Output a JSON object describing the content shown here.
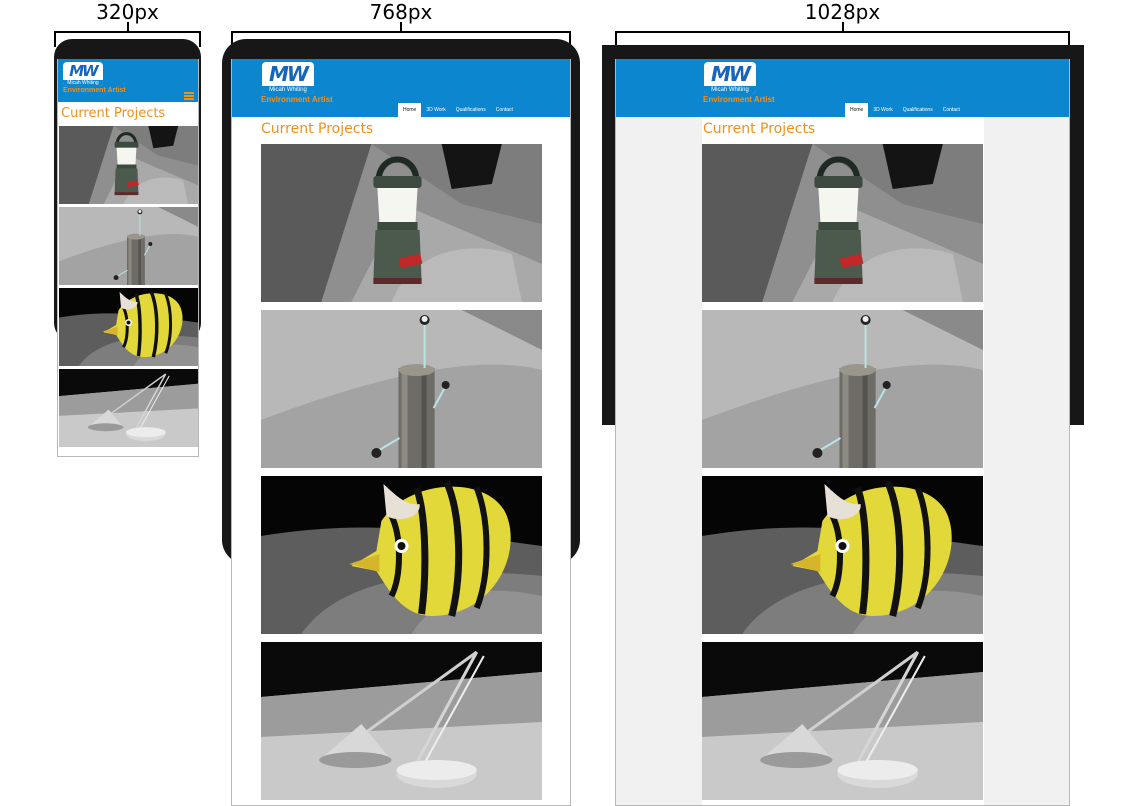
{
  "breakpoints": [
    {
      "label": "320px"
    },
    {
      "label": "768px"
    },
    {
      "label": "1028px"
    }
  ],
  "site": {
    "logo_text": "MW",
    "logo_name": "Micah Whiting",
    "subtitle": "Environment Artist",
    "nav": [
      "Home",
      "3D Work",
      "Qualifications",
      "Contact"
    ],
    "heading": "Current Projects",
    "projects": [
      {
        "name": "lantern",
        "icon": "lantern-render"
      },
      {
        "name": "pole",
        "icon": "wooden-post-render"
      },
      {
        "name": "fish",
        "icon": "striped-fish-render"
      },
      {
        "name": "desk-lamp",
        "icon": "desk-lamp-render"
      }
    ]
  },
  "colors": {
    "header": "#0c86cf",
    "accent": "#f0901c",
    "logo_blue": "#1665bd"
  }
}
